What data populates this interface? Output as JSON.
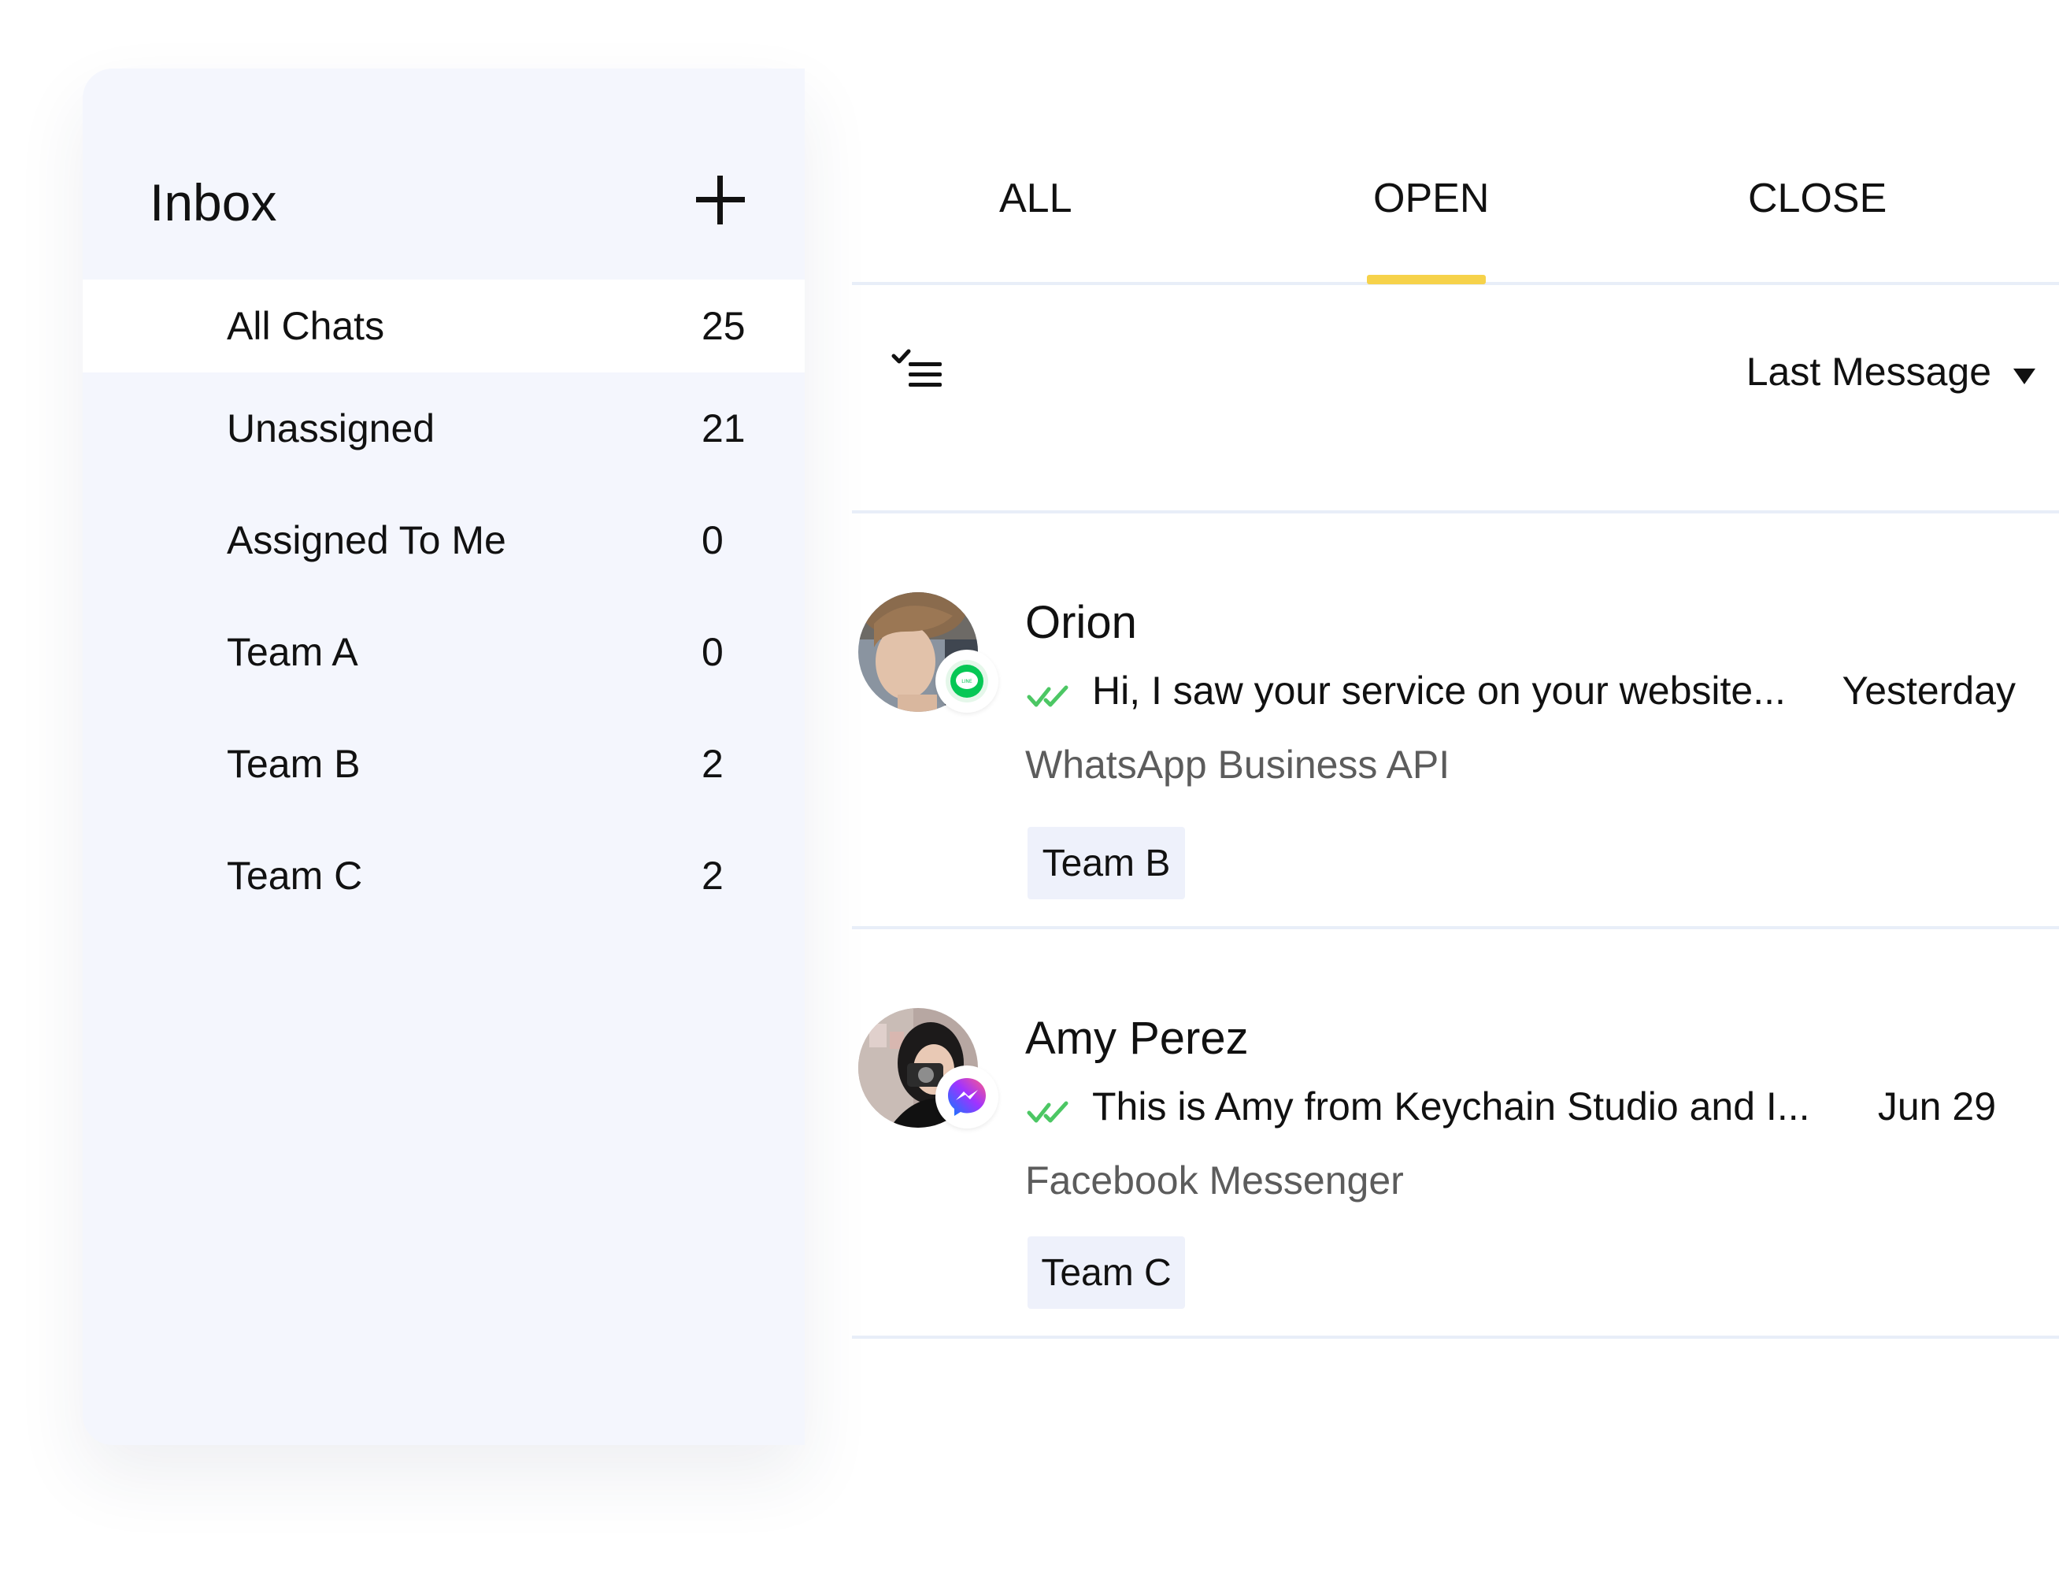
{
  "sidebar": {
    "title": "Inbox",
    "add_icon": "plus-icon",
    "items": [
      {
        "label": "All Chats",
        "count": "25",
        "active": true
      },
      {
        "label": "Unassigned",
        "count": "21"
      },
      {
        "label": "Assigned To Me",
        "count": "0"
      },
      {
        "label": "Team A",
        "count": "0"
      },
      {
        "label": "Team B",
        "count": "2"
      },
      {
        "label": "Team C",
        "count": "2"
      }
    ]
  },
  "tabs": [
    {
      "label": "ALL"
    },
    {
      "label": "OPEN",
      "active": true
    },
    {
      "label": "CLOSE"
    }
  ],
  "toolbar": {
    "filter_icon": "checklist-filter-icon",
    "sort_label": "Last Message",
    "sort_icon": "caret-down-icon"
  },
  "chats": [
    {
      "name": "Orion",
      "preview": "Hi, I saw your service on your website...",
      "time": "Yesterday",
      "channel": "WhatsApp Business API",
      "team": "Team B",
      "badge_icon": "line-icon",
      "status_icon": "double-check-icon"
    },
    {
      "name": "Amy Perez",
      "preview": "This is Amy from Keychain Studio and I...",
      "time": "Jun 29",
      "channel": "Facebook Messenger",
      "team": "Team C",
      "badge_icon": "messenger-icon",
      "status_icon": "double-check-icon"
    }
  ],
  "colors": {
    "sidebar_bg": "#f4f6fd",
    "tab_indicator": "#f6d24a",
    "check_green": "#4cc764",
    "tag_bg": "#eef1fb",
    "line_green": "#06c755"
  }
}
